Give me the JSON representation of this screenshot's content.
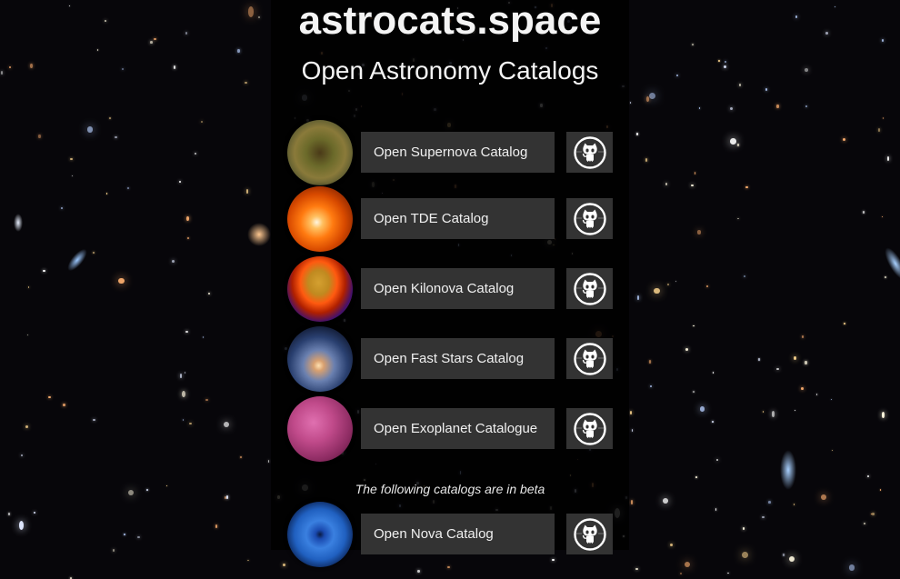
{
  "header": {
    "title": "astrocats.space",
    "subtitle": "Open Astronomy Catalogs"
  },
  "catalogs": [
    {
      "label": "Open Supernova Catalog",
      "icon": "supernova-remnant-image",
      "github_icon": "github-octocat-icon"
    },
    {
      "label": "Open TDE Catalog",
      "icon": "tidal-disruption-event-image",
      "github_icon": "github-octocat-icon"
    },
    {
      "label": "Open Kilonova Catalog",
      "icon": "kilonova-image",
      "github_icon": "github-octocat-icon"
    },
    {
      "label": "Open Fast Stars Catalog",
      "icon": "fast-star-galaxy-image",
      "github_icon": "github-octocat-icon"
    },
    {
      "label": "Open Exoplanet Catalogue",
      "icon": "exoplanet-image",
      "github_icon": "github-octocat-icon"
    }
  ],
  "beta_notice": "The following catalogs are in beta",
  "beta_catalogs": [
    {
      "label": "Open Nova Catalog",
      "icon": "nova-image",
      "github_icon": "github-octocat-icon"
    }
  ],
  "colors": {
    "button_bg": "#333333",
    "page_bg": "#07060a"
  }
}
